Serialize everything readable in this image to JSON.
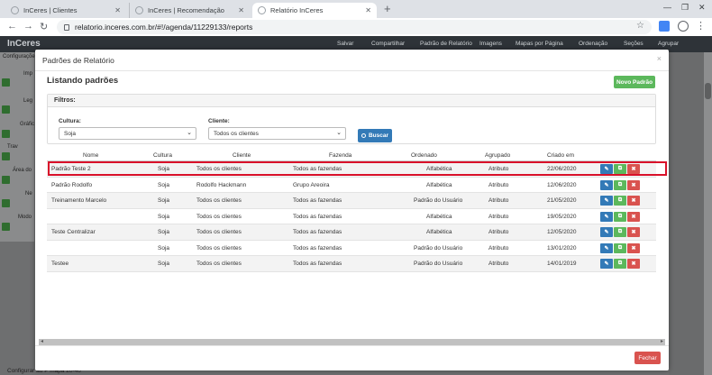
{
  "browser": {
    "tabs": [
      {
        "label": "InCeres | Clientes"
      },
      {
        "label": "InCeres | Recomendação"
      },
      {
        "label": "Relatório InCeres"
      }
    ],
    "url": "relatorio.inceres.com.br/#!/agenda/11229133/reports"
  },
  "app": {
    "logo": "InCeres",
    "menu": [
      "Salvar",
      "Compartilhar",
      "Padrão de Relatório",
      "Imagens",
      "Mapas por Página",
      "Ordenação",
      "Seções",
      "Agrupar"
    ],
    "side_labels": [
      "Configurações",
      "Imp",
      "Leg",
      "Gráfic",
      "Trav",
      "Área do",
      "Ne",
      "Modo"
    ],
    "footer_text": "Configurar ao P mapa 20-40"
  },
  "modal": {
    "title": "Padrões de Relatório",
    "close": "×",
    "section_title": "Listando padrões",
    "new_button": "Novo Padrão",
    "filters_title": "Filtros:",
    "cultura_label": "Cultura:",
    "cultura_value": "Soja",
    "cliente_label": "Cliente:",
    "cliente_value": "Todos os clientes",
    "search_button": "Buscar",
    "close_button": "Fechar"
  },
  "table": {
    "headers": [
      "Nome",
      "Cultura",
      "Cliente",
      "Fazenda",
      "Ordenado",
      "Agrupado",
      "Criado em"
    ],
    "rows": [
      {
        "nome": "Padrão Teste 2",
        "cultura": "Soja",
        "cliente": "Todos os clientes",
        "fazenda": "Todos as fazendas",
        "ordenado": "Alfabética",
        "agrupado": "Atributo",
        "criado": "22/06/2020"
      },
      {
        "nome": "Padrão Rodolfo",
        "cultura": "Soja",
        "cliente": "Rodolfo Hackmann",
        "fazenda": "Grupo Areoira",
        "ordenado": "Alfabética",
        "agrupado": "Atributo",
        "criado": "12/06/2020"
      },
      {
        "nome": "Treinamento Marcelo",
        "cultura": "Soja",
        "cliente": "Todos os clientes",
        "fazenda": "Todos as fazendas",
        "ordenado": "Padrão do Usuário",
        "agrupado": "Atributo",
        "criado": "21/05/2020"
      },
      {
        "nome": "",
        "cultura": "Soja",
        "cliente": "Todos os clientes",
        "fazenda": "Todos as fazendas",
        "ordenado": "Alfabética",
        "agrupado": "Atributo",
        "criado": "19/05/2020"
      },
      {
        "nome": "Teste Centralizar",
        "cultura": "Soja",
        "cliente": "Todos os clientes",
        "fazenda": "Todos as fazendas",
        "ordenado": "Alfabética",
        "agrupado": "Atributo",
        "criado": "12/05/2020"
      },
      {
        "nome": "",
        "cultura": "Soja",
        "cliente": "Todos os clientes",
        "fazenda": "Todos as fazendas",
        "ordenado": "Padrão do Usuário",
        "agrupado": "Atributo",
        "criado": "13/01/2020"
      },
      {
        "nome": "Testee",
        "cultura": "Soja",
        "cliente": "Todos os clientes",
        "fazenda": "Todos as fazendas",
        "ordenado": "Padrão do Usuário",
        "agrupado": "Atributo",
        "criado": "14/01/2019"
      }
    ]
  },
  "colors": {
    "highlight": "#d9112a",
    "edit": "#337ab7",
    "copy": "#5cb85c",
    "delete": "#d9534f"
  }
}
